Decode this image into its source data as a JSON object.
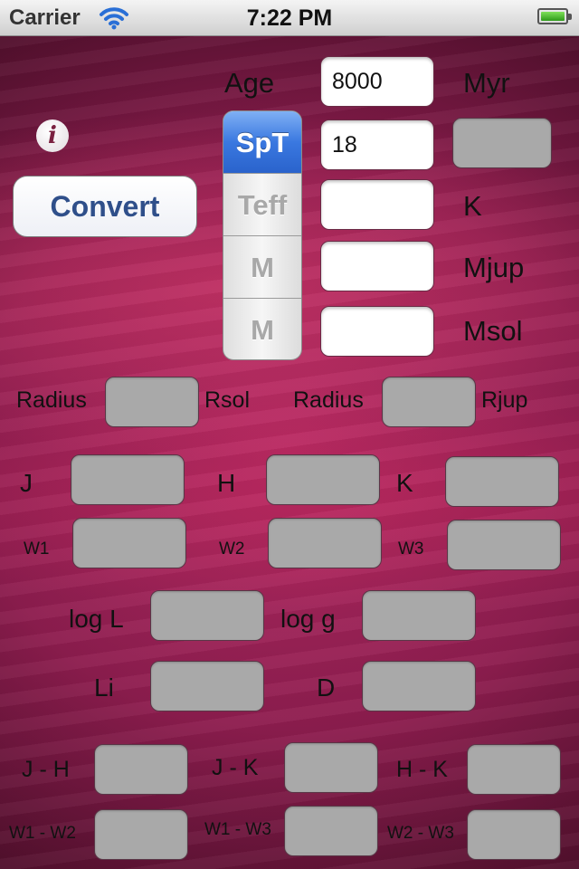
{
  "status_bar": {
    "carrier": "Carrier",
    "time": "7:22 PM"
  },
  "inputs": {
    "age": {
      "label": "Age",
      "value": "8000",
      "unit": "Myr"
    },
    "spt": {
      "value": "18"
    },
    "teff": {
      "value": "",
      "unit": "K"
    },
    "mass_jup": {
      "value": "",
      "unit": "Mjup"
    },
    "mass_sol": {
      "value": "",
      "unit": "Msol"
    }
  },
  "segments": [
    "SpT",
    "Teff",
    "M",
    "M"
  ],
  "selected_segment": "SpT",
  "convert_label": "Convert",
  "info_symbol": "i",
  "radius": {
    "label_1": "Radius",
    "unit_1": "Rsol",
    "label_2": "Radius",
    "unit_2": "Rjup"
  },
  "mags": [
    "J",
    "H",
    "K",
    "W1",
    "W2",
    "W3"
  ],
  "props": {
    "logl": "log L",
    "logg": "log g",
    "li": "Li",
    "d": "D"
  },
  "colors": [
    "J - H",
    "J - K",
    "H - K",
    "W1 - W2",
    "W1 - W3",
    "W2 - W3"
  ]
}
